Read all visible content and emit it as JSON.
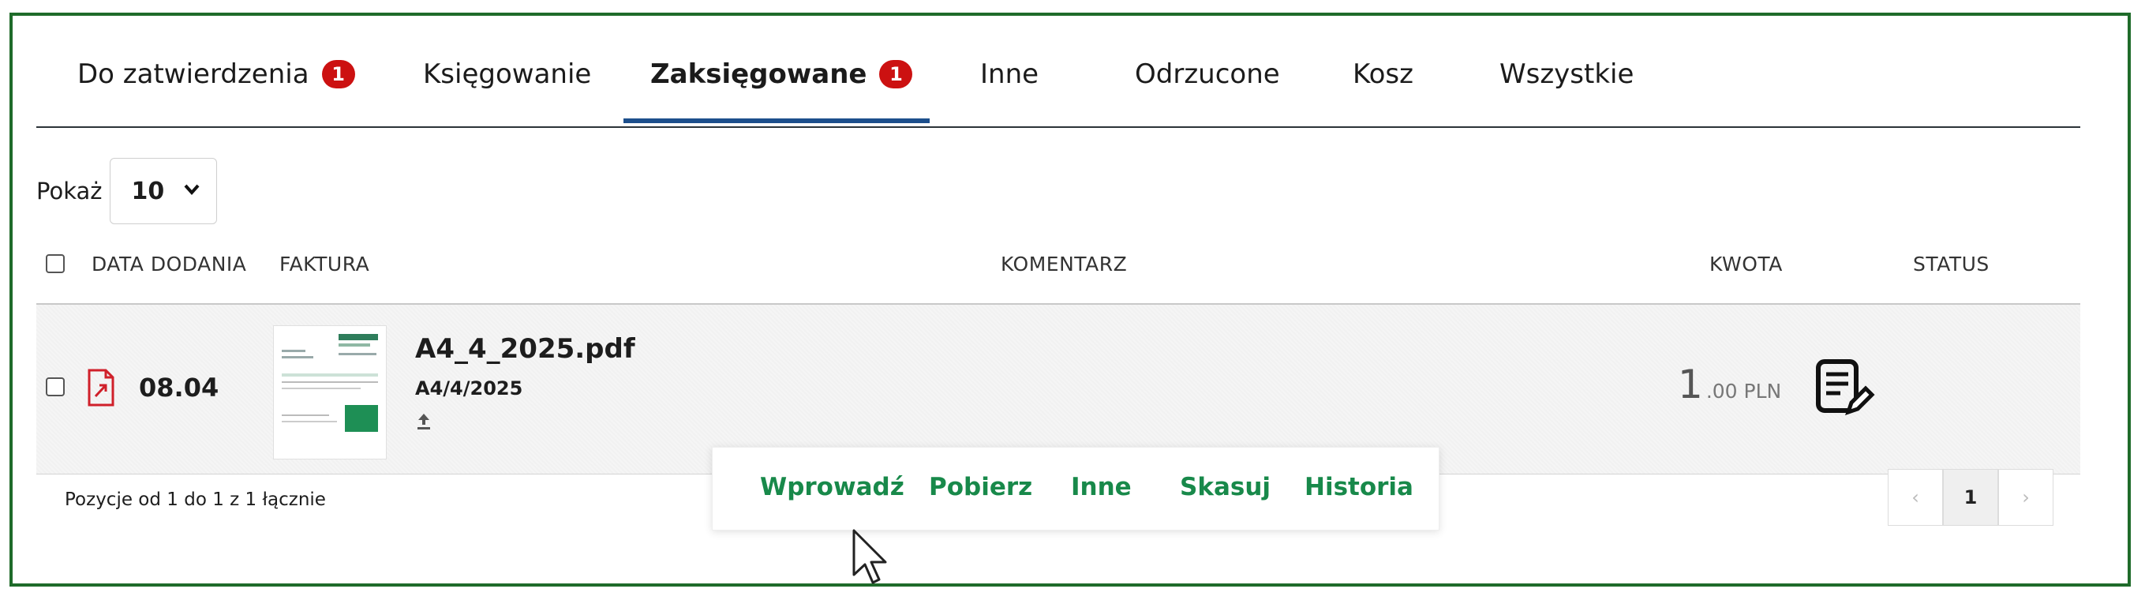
{
  "tabs": [
    {
      "label": "Do zatwierdzenia",
      "badge": "1"
    },
    {
      "label": "Księgowanie"
    },
    {
      "label": "Zaksięgowane",
      "badge": "1",
      "active": true
    },
    {
      "label": "Inne"
    },
    {
      "label": "Odrzucone"
    },
    {
      "label": "Kosz"
    },
    {
      "label": "Wszystkie"
    }
  ],
  "show": {
    "label": "Pokaż",
    "value": "10"
  },
  "table": {
    "headers": {
      "date": "DATA DODANIA",
      "invoice": "FAKTURA",
      "comment": "KOMENTARZ",
      "amount": "KWOTA",
      "status": "STATUS"
    },
    "rows": [
      {
        "date": "08.04",
        "file_name": "A4_4_2025.pdf",
        "invoice_number": "A4/4/2025",
        "amount_main": "1",
        "amount_rest": ".00 PLN"
      }
    ]
  },
  "footer": {
    "summary": "Pozycje od 1 do 1 z 1 łącznie"
  },
  "pagination": {
    "prev": "‹",
    "current": "1",
    "next": "›"
  },
  "context_menu": [
    "Wprowadź",
    "Pobierz",
    "Inne",
    "Skasuj",
    "Historia"
  ],
  "colors": {
    "frame": "#1f6b2a",
    "accent_green": "#18894a",
    "badge_red": "#cc1111",
    "tab_underline": "#1d4f8c"
  }
}
